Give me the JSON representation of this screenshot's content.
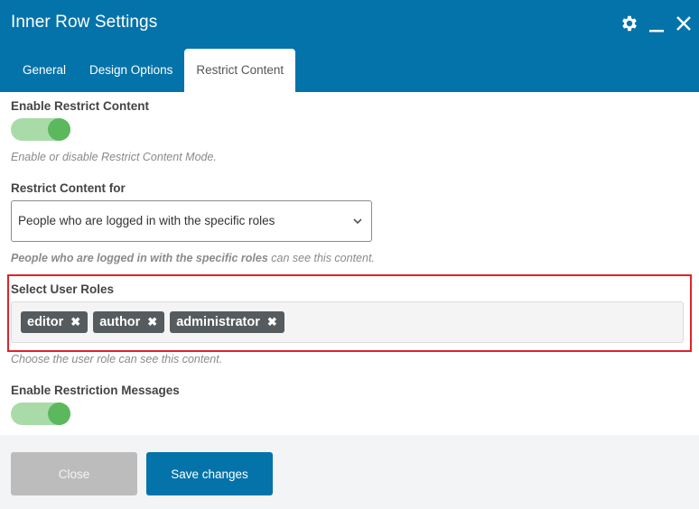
{
  "header": {
    "title": "Inner Row Settings",
    "icons": [
      "gear-icon",
      "minimize-icon",
      "close-icon"
    ]
  },
  "tabs": [
    {
      "label": "General",
      "active": false
    },
    {
      "label": "Design Options",
      "active": false
    },
    {
      "label": "Restrict Content",
      "active": true
    }
  ],
  "fields": {
    "enable_restrict": {
      "label": "Enable Restrict Content",
      "enabled": true,
      "help": "Enable or disable Restrict Content Mode."
    },
    "restrict_for": {
      "label": "Restrict Content for",
      "value": "People who are logged in with the specific roles",
      "help_bold": "People who are logged in with the specific roles",
      "help_rest": " can see this content."
    },
    "user_roles": {
      "label": "Select User Roles",
      "tags": [
        "editor",
        "author",
        "administrator"
      ],
      "remove_glyph": "✖",
      "help": "Choose the user role can see this content."
    },
    "enable_messages": {
      "label": "Enable Restriction Messages",
      "enabled": true
    }
  },
  "footer": {
    "close_label": "Close",
    "save_label": "Save changes"
  },
  "colors": {
    "brand": "#0473aa",
    "toggle_on": "#5cb85c",
    "highlight": "#e0222a"
  }
}
